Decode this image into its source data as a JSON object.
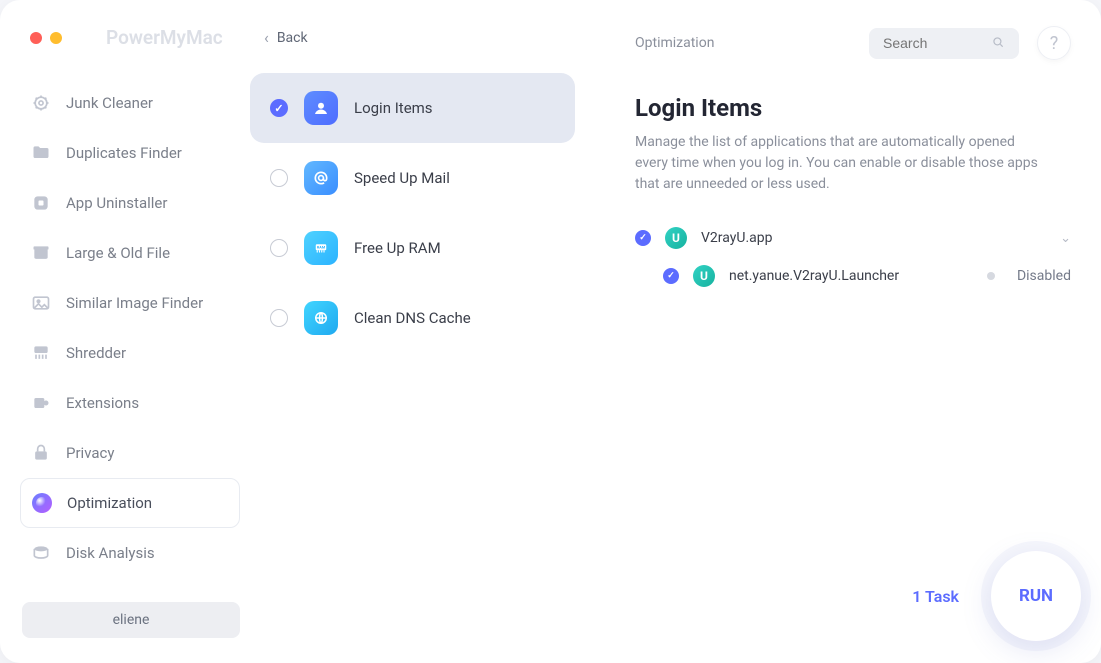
{
  "app_title": "PowerMyMac",
  "back_label": "Back",
  "user": "eliene",
  "sidebar": [
    {
      "label": "Junk Cleaner",
      "icon": "gear",
      "active": false
    },
    {
      "label": "Duplicates Finder",
      "icon": "folder",
      "active": false
    },
    {
      "label": "App Uninstaller",
      "icon": "app",
      "active": false
    },
    {
      "label": "Large & Old File",
      "icon": "box",
      "active": false
    },
    {
      "label": "Similar Image Finder",
      "icon": "image",
      "active": false
    },
    {
      "label": "Shredder",
      "icon": "shredder",
      "active": false
    },
    {
      "label": "Extensions",
      "icon": "ext",
      "active": false
    },
    {
      "label": "Privacy",
      "icon": "lock",
      "active": false
    },
    {
      "label": "Optimization",
      "icon": "opt",
      "active": true
    },
    {
      "label": "Disk Analysis",
      "icon": "disk",
      "active": false
    }
  ],
  "middle": {
    "options": [
      {
        "label": "Login Items",
        "checked": true,
        "color": "linear-gradient(135deg,#5e8dff,#4e6cff)",
        "glyph": "user"
      },
      {
        "label": "Speed Up Mail",
        "checked": false,
        "color": "linear-gradient(135deg,#62b8ff,#3a8eff)",
        "glyph": "at"
      },
      {
        "label": "Free Up RAM",
        "checked": false,
        "color": "linear-gradient(135deg,#4fd2ff,#2bb3ff)",
        "glyph": "ram"
      },
      {
        "label": "Clean DNS Cache",
        "checked": false,
        "color": "linear-gradient(135deg,#41d5ff,#1fa9f0)",
        "glyph": "dns"
      }
    ]
  },
  "right": {
    "breadcrumb": "Optimization",
    "search_placeholder": "Search",
    "title": "Login Items",
    "description": "Manage the list of applications that are automatically opened every time when you log in. You can enable or disable those apps that are unneeded or less used.",
    "items": [
      {
        "name": "V2rayU.app",
        "children": [
          {
            "name": "net.yanue.V2rayU.Launcher",
            "status": "Disabled"
          }
        ]
      }
    ],
    "task_count": "1 Task",
    "run_label": "RUN"
  }
}
